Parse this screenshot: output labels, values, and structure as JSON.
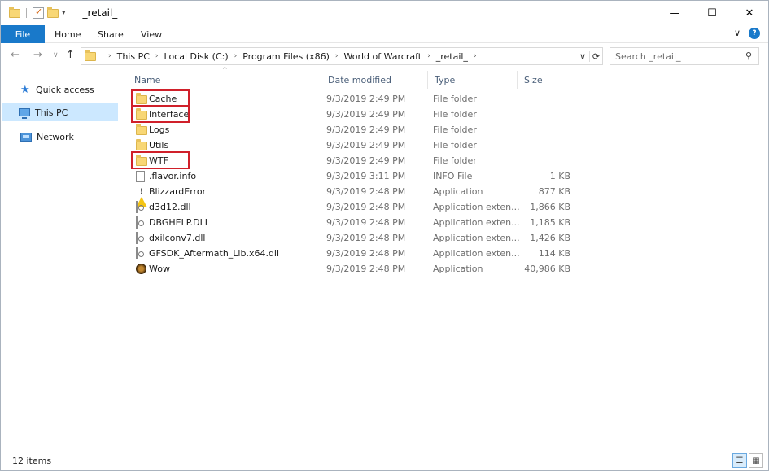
{
  "window": {
    "title": "_retail_",
    "controls": {
      "minimize": "—",
      "maximize": "☐",
      "close": "✕"
    }
  },
  "ribbon": {
    "file": "File",
    "tabs": [
      "Home",
      "Share",
      "View"
    ],
    "expand_glyph": "∨",
    "help_glyph": "?"
  },
  "nav": {
    "back": "←",
    "forward": "→",
    "recent": "∨",
    "up": "↑",
    "breadcrumbs": [
      "This PC",
      "Local Disk (C:)",
      "Program Files (x86)",
      "World of Warcraft",
      "_retail_"
    ],
    "refresh": "⟳",
    "dropdown": "∨",
    "search_placeholder": "Search _retail_"
  },
  "sidebar": {
    "items": [
      {
        "label": "Quick access",
        "icon": "star-icon"
      },
      {
        "label": "This PC",
        "icon": "computer-icon"
      },
      {
        "label": "Network",
        "icon": "network-icon"
      }
    ]
  },
  "columns": {
    "name": "Name",
    "date": "Date modified",
    "type": "Type",
    "size": "Size"
  },
  "files": [
    {
      "name": "Cache",
      "date": "9/3/2019 2:49 PM",
      "type": "File folder",
      "size": "",
      "icon": "folder-icon",
      "highlighted": true
    },
    {
      "name": "Interface",
      "date": "9/3/2019 2:49 PM",
      "type": "File folder",
      "size": "",
      "icon": "folder-icon",
      "highlighted": true
    },
    {
      "name": "Logs",
      "date": "9/3/2019 2:49 PM",
      "type": "File folder",
      "size": "",
      "icon": "folder-icon",
      "highlighted": false
    },
    {
      "name": "Utils",
      "date": "9/3/2019 2:49 PM",
      "type": "File folder",
      "size": "",
      "icon": "folder-icon",
      "highlighted": false
    },
    {
      "name": "WTF",
      "date": "9/3/2019 2:49 PM",
      "type": "File folder",
      "size": "",
      "icon": "folder-icon",
      "highlighted": true
    },
    {
      "name": ".flavor.info",
      "date": "9/3/2019 3:11 PM",
      "type": "INFO File",
      "size": "1 KB",
      "icon": "document-icon",
      "highlighted": false
    },
    {
      "name": "BlizzardError",
      "date": "9/3/2019 2:48 PM",
      "type": "Application",
      "size": "877 KB",
      "icon": "warning-icon",
      "highlighted": false
    },
    {
      "name": "d3d12.dll",
      "date": "9/3/2019 2:48 PM",
      "type": "Application exten...",
      "size": "1,866 KB",
      "icon": "dll-icon",
      "highlighted": false
    },
    {
      "name": "DBGHELP.DLL",
      "date": "9/3/2019 2:48 PM",
      "type": "Application exten...",
      "size": "1,185 KB",
      "icon": "dll-icon",
      "highlighted": false
    },
    {
      "name": "dxilconv7.dll",
      "date": "9/3/2019 2:48 PM",
      "type": "Application exten...",
      "size": "1,426 KB",
      "icon": "dll-icon",
      "highlighted": false
    },
    {
      "name": "GFSDK_Aftermath_Lib.x64.dll",
      "date": "9/3/2019 2:48 PM",
      "type": "Application exten...",
      "size": "114 KB",
      "icon": "dll-icon",
      "highlighted": false
    },
    {
      "name": "Wow",
      "date": "9/3/2019 2:48 PM",
      "type": "Application",
      "size": "40,986 KB",
      "icon": "wow-icon",
      "highlighted": false
    }
  ],
  "status": {
    "count": "12 items"
  },
  "colors": {
    "accent": "#1979ca",
    "selection": "#cce8ff",
    "highlight_border": "#d0202a"
  }
}
